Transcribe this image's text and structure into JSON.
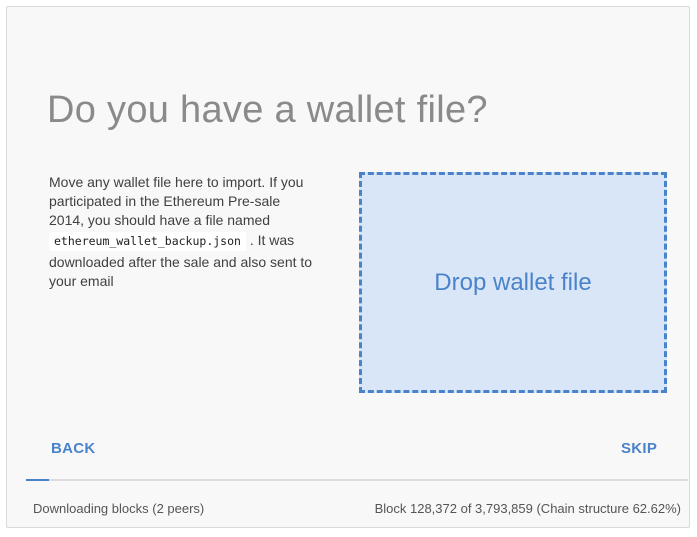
{
  "title": "Do you have a wallet file?",
  "description": {
    "intro": "Move any wallet file here to import. If you participated in the Ethereum Pre-sale 2014, you should have a file named",
    "filename": "ethereum_wallet_backup.json",
    "outro": ". It was downloaded after the sale and also sent to your email"
  },
  "dropzone": {
    "label": "Drop wallet file"
  },
  "buttons": {
    "back": "BACK",
    "skip": "SKIP"
  },
  "status": {
    "downloading": "Downloading blocks (2 peers)",
    "block_info": "Block 128,372 of 3,793,859 (Chain structure 62.62%)",
    "progress_fraction": 0.034
  },
  "colors": {
    "accent": "#4a83c9",
    "dropzone_bg": "#d9e6f7",
    "title": "#8a8a8a"
  }
}
